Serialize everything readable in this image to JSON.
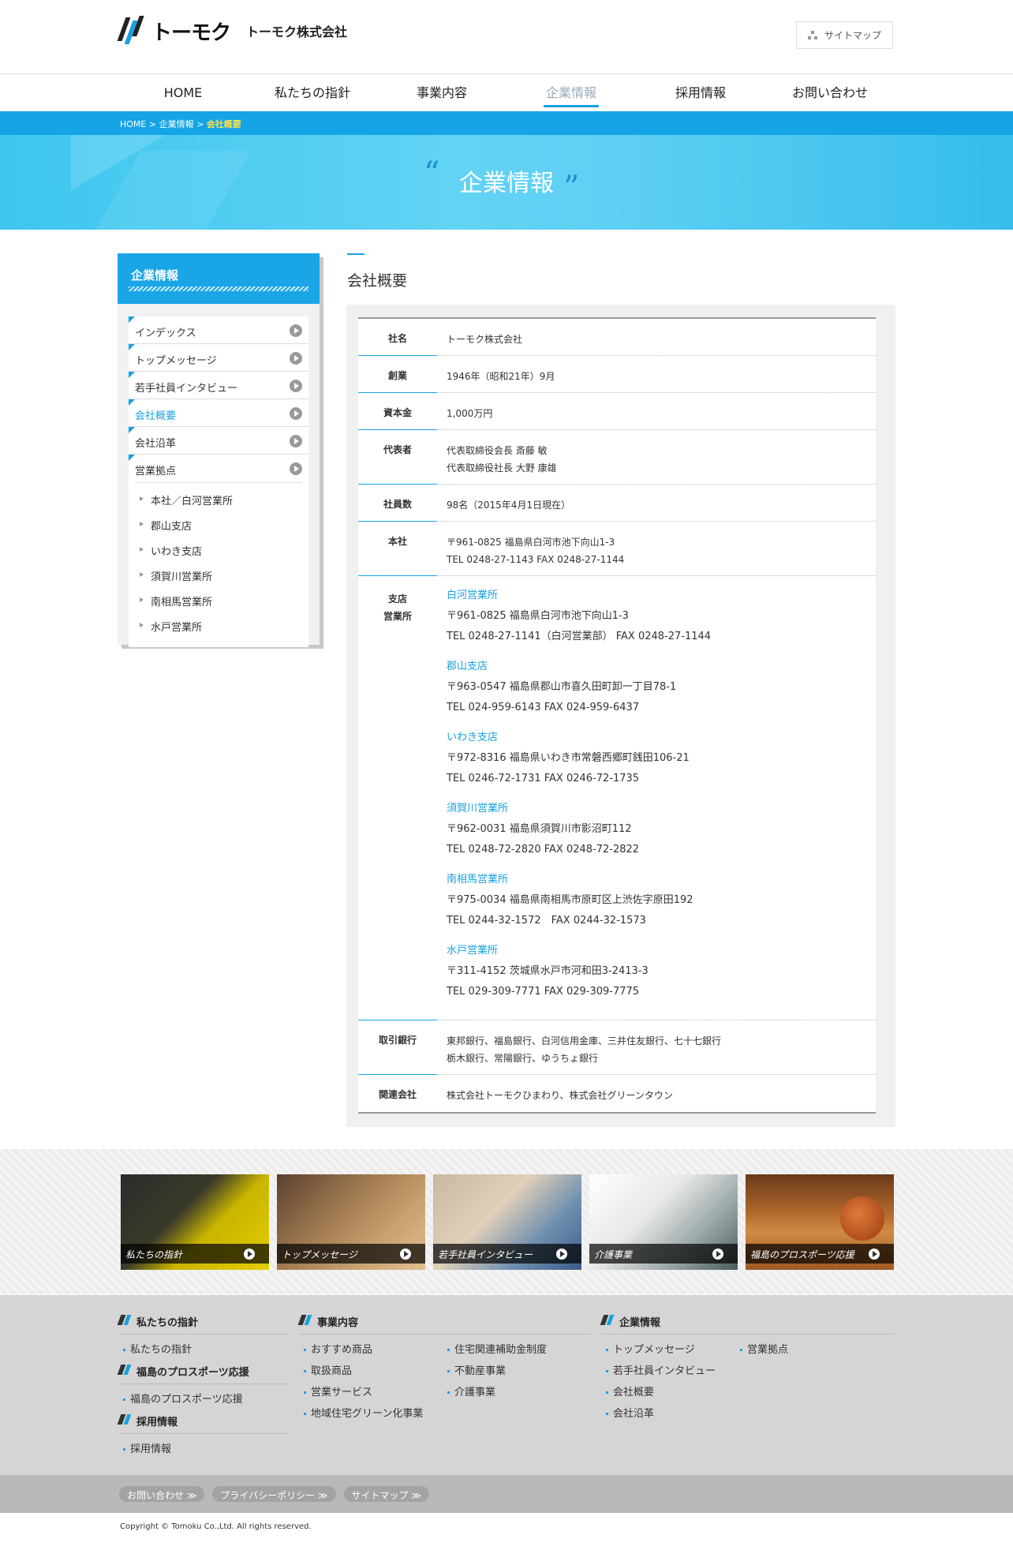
{
  "header": {
    "logo_word": "トーモク",
    "company": "トーモク株式会社",
    "sitemap_label": "サイトマップ"
  },
  "nav": [
    {
      "label": "HOME"
    },
    {
      "label": "私たちの指針"
    },
    {
      "label": "事業内容"
    },
    {
      "label": "企業情報"
    },
    {
      "label": "採用情報"
    },
    {
      "label": "お問い合わせ"
    }
  ],
  "breadcrumb": {
    "home": "HOME",
    "sep1": ">",
    "section": "企業情報",
    "sep2": ">",
    "current": "会社概要"
  },
  "hero": {
    "title": "企業情報",
    "open_quote": "“",
    "close_quote": "”"
  },
  "sidebar": {
    "title": "企業情報",
    "items": [
      {
        "label": "インデックス"
      },
      {
        "label": "トップメッセージ"
      },
      {
        "label": "若手社員インタビュー"
      },
      {
        "label": "会社概要"
      },
      {
        "label": "会社沿革"
      },
      {
        "label": "営業拠点"
      }
    ],
    "sub_items": [
      {
        "label": "本社／白河営業所"
      },
      {
        "label": "郡山支店"
      },
      {
        "label": "いわき支店"
      },
      {
        "label": "須賀川営業所"
      },
      {
        "label": "南相馬営業所"
      },
      {
        "label": "水戸営業所"
      }
    ]
  },
  "main": {
    "title": "会社概要",
    "rows": {
      "name": {
        "label": "社名",
        "value": "トーモク株式会社"
      },
      "founded": {
        "label": "創業",
        "value": "1946年（昭和21年）9月"
      },
      "capital": {
        "label": "資本金",
        "value": "1,000万円"
      },
      "rep": {
        "label": "代表者",
        "line1": "代表取締役会長 斎藤 敏",
        "line2": "代表取締役社長 大野 康雄"
      },
      "employees": {
        "label": "社員数",
        "value": "98名（2015年4月1日現在）"
      },
      "hq": {
        "label": "本社",
        "line1": "〒961-0825 福島県白河市池下向山1-3",
        "line2": "TEL 0248-27-1143 FAX 0248-27-1144"
      },
      "branches": {
        "label1": "支店",
        "label2": "営業所",
        "list": [
          {
            "name": "白河営業所",
            "addr": "〒961-0825 福島県白河市池下向山1-3",
            "tel": "TEL 0248-27-1141（白河営業部） FAX 0248-27-1144"
          },
          {
            "name": "郡山支店",
            "addr": "〒963-0547 福島県郡山市喜久田町卸一丁目78-1",
            "tel": "TEL 024-959-6143 FAX 024-959-6437"
          },
          {
            "name": "いわき支店",
            "addr": "〒972-8316 福島県いわき市常磐西郷町銭田106-21",
            "tel": "TEL 0246-72-1731 FAX 0246-72-1735"
          },
          {
            "name": "須賀川営業所",
            "addr": "〒962-0031 福島県須賀川市影沼町112",
            "tel": "TEL 0248-72-2820 FAX 0248-72-2822"
          },
          {
            "name": "南相馬営業所",
            "addr": "〒975-0034 福島県南相馬市原町区上渋佐字原田192",
            "tel": "TEL 0244-32-1572　FAX 0244-32-1573"
          },
          {
            "name": "水戸営業所",
            "addr": "〒311-4152 茨城県水戸市河和田3-2413-3",
            "tel": "TEL 029-309-7771 FAX 029-309-7775"
          }
        ]
      },
      "banks": {
        "label": "取引銀行",
        "line1": "東邦銀行、福島銀行、白河信用金庫、三井住友銀行、七十七銀行",
        "line2": "栃木銀行、常陽銀行、ゆうちょ銀行"
      },
      "related": {
        "label": "関連会社",
        "value": "株式会社トーモクひまわり、株式会社グリーンタウン"
      }
    }
  },
  "banners": [
    {
      "caption": "私たちの指針"
    },
    {
      "caption": "トップメッセージ"
    },
    {
      "caption": "若手社員インタビュー"
    },
    {
      "caption": "介護事業"
    },
    {
      "caption": "福島のプロスポーツ応援"
    }
  ],
  "footer": {
    "col1": {
      "head1": "私たちの指針",
      "links1": [
        "私たちの指針"
      ],
      "head2": "福島のプロスポーツ応援",
      "links2": [
        "福島のプロスポーツ応援"
      ],
      "head3": "採用情報",
      "links3": [
        "採用情報"
      ]
    },
    "col2": {
      "head": "事業内容",
      "links_a": [
        "おすすめ商品",
        "取扱商品",
        "営業サービス",
        "地域住宅グリーン化事業"
      ],
      "links_b": [
        "住宅関連補助金制度",
        "不動産事業",
        "介護事業"
      ]
    },
    "col3": {
      "head": "企業情報",
      "links_a": [
        "トップメッセージ",
        "若手社員インタビュー",
        "会社概要",
        "会社沿革"
      ],
      "links_b": [
        "営業拠点"
      ]
    },
    "pills": [
      "お問い合わせ ≫",
      "プライバシーポリシー ≫",
      "サイトマップ ≫"
    ],
    "copyright": "Copyright © Tomoku Co.,Ltd. All rights reserved."
  },
  "colors": {
    "accent": "#16a2e0",
    "crumb_current": "#ffe14a"
  }
}
